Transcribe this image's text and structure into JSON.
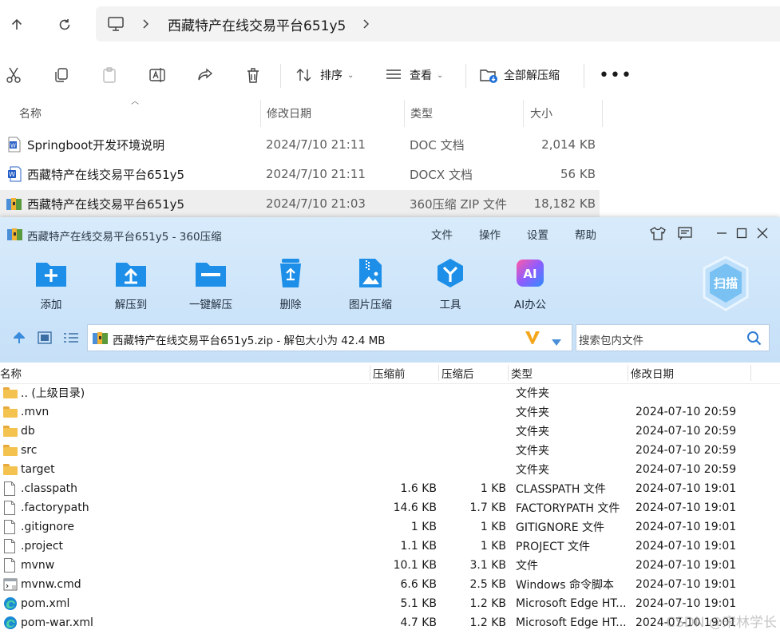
{
  "explorer": {
    "breadcrumb": {
      "folder": "西藏特产在线交易平台651y5"
    },
    "toolbar": {
      "sort_label": "排序",
      "view_label": "查看",
      "extract_all_label": "全部解压缩"
    },
    "columns": {
      "name": "名称",
      "date": "修改日期",
      "type": "类型",
      "size": "大小"
    },
    "files": [
      {
        "name": "Springboot开发环境说明",
        "date": "2024/7/10 21:11",
        "type": "DOC 文档",
        "size": "2,014 KB",
        "icon": "word-doc-icon"
      },
      {
        "name": "西藏特产在线交易平台651y5",
        "date": "2024/7/10 21:11",
        "type": "DOCX 文档",
        "size": "56 KB",
        "icon": "word-docx-icon"
      },
      {
        "name": "西藏特产在线交易平台651y5",
        "date": "2024/7/10 21:03",
        "type": "360压缩 ZIP 文件",
        "size": "18,182 KB",
        "icon": "zip-archive-icon",
        "selected": true
      }
    ]
  },
  "zip_window": {
    "title": "西藏特产在线交易平台651y5 - 360压缩",
    "menu": [
      "文件",
      "操作",
      "设置",
      "帮助"
    ],
    "tools": [
      {
        "label": "添加",
        "icon": "add-icon"
      },
      {
        "label": "解压到",
        "icon": "extract-to-icon"
      },
      {
        "label": "一键解压",
        "icon": "one-click-extract-icon"
      },
      {
        "label": "删除",
        "icon": "recycle-bin-icon"
      },
      {
        "label": "图片压缩",
        "icon": "image-compress-icon"
      },
      {
        "label": "工具",
        "icon": "tools-icon"
      },
      {
        "label": "AI办公",
        "icon": "ai-office-icon"
      }
    ],
    "scan_label": "扫描",
    "path_text": "西藏特产在线交易平台651y5.zip - 解包大小为 42.4 MB",
    "search_placeholder": "搜索包内文件",
    "columns": {
      "name": "名称",
      "packed": "压缩前",
      "compressed": "压缩后",
      "type": "类型",
      "date": "修改日期"
    },
    "rows": [
      {
        "name": ".. (上级目录)",
        "packed": "",
        "compressed": "",
        "type": "文件夹",
        "date": "",
        "icon": "folder-icon"
      },
      {
        "name": ".mvn",
        "packed": "",
        "compressed": "",
        "type": "文件夹",
        "date": "2024-07-10 20:59",
        "icon": "folder-icon"
      },
      {
        "name": "db",
        "packed": "",
        "compressed": "",
        "type": "文件夹",
        "date": "2024-07-10 20:59",
        "icon": "folder-icon"
      },
      {
        "name": "src",
        "packed": "",
        "compressed": "",
        "type": "文件夹",
        "date": "2024-07-10 20:59",
        "icon": "folder-icon"
      },
      {
        "name": "target",
        "packed": "",
        "compressed": "",
        "type": "文件夹",
        "date": "2024-07-10 20:59",
        "icon": "folder-icon"
      },
      {
        "name": ".classpath",
        "packed": "1.6 KB",
        "compressed": "1 KB",
        "type": "CLASSPATH 文件",
        "date": "2024-07-10 19:01",
        "icon": "file-icon"
      },
      {
        "name": ".factorypath",
        "packed": "14.6 KB",
        "compressed": "1.7 KB",
        "type": "FACTORYPATH 文件",
        "date": "2024-07-10 19:01",
        "icon": "file-icon"
      },
      {
        "name": ".gitignore",
        "packed": "1 KB",
        "compressed": "1 KB",
        "type": "GITIGNORE 文件",
        "date": "2024-07-10 19:01",
        "icon": "file-icon"
      },
      {
        "name": ".project",
        "packed": "1.1 KB",
        "compressed": "1 KB",
        "type": "PROJECT 文件",
        "date": "2024-07-10 19:01",
        "icon": "file-icon"
      },
      {
        "name": "mvnw",
        "packed": "10.1 KB",
        "compressed": "3.1 KB",
        "type": "文件",
        "date": "2024-07-10 19:01",
        "icon": "file-icon"
      },
      {
        "name": "mvnw.cmd",
        "packed": "6.6 KB",
        "compressed": "2.5 KB",
        "type": "Windows 命令脚本",
        "date": "2024-07-10 19:01",
        "icon": "cmd-script-icon"
      },
      {
        "name": "pom.xml",
        "packed": "5.1 KB",
        "compressed": "1.2 KB",
        "type": "Microsoft Edge HT...",
        "date": "2024-07-10 19:01",
        "icon": "edge-icon"
      },
      {
        "name": "pom-war.xml",
        "packed": "4.7 KB",
        "compressed": "1.2 KB",
        "type": "Microsoft Edge HT...",
        "date": "2024-07-10 19:01",
        "icon": "edge-icon"
      }
    ]
  },
  "watermark": "CSDN @宋林学长"
}
